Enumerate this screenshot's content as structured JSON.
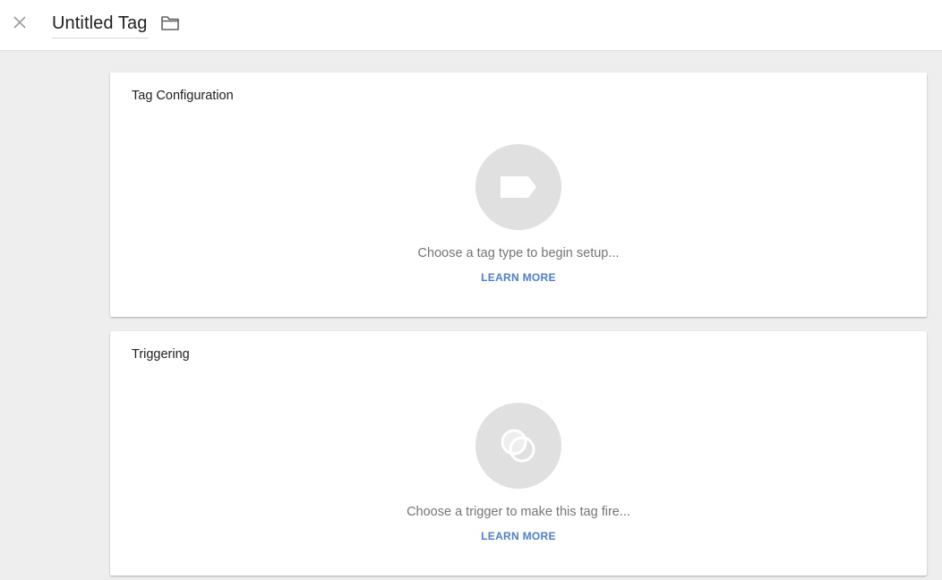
{
  "header": {
    "close_icon": "close-icon",
    "title": "Untitled Tag",
    "folder_icon": "folder-icon"
  },
  "tag_configuration": {
    "title": "Tag Configuration",
    "icon": "tag-icon",
    "prompt": "Choose a tag type to begin setup...",
    "learn_more": "LEARN MORE"
  },
  "triggering": {
    "title": "Triggering",
    "icon": "trigger-icon",
    "prompt": "Choose a trigger to make this tag fire...",
    "learn_more": "LEARN MORE"
  },
  "colors": {
    "link": "#4a80d9",
    "background": "#eeeeee",
    "icon_circle": "#e0e0e0"
  }
}
